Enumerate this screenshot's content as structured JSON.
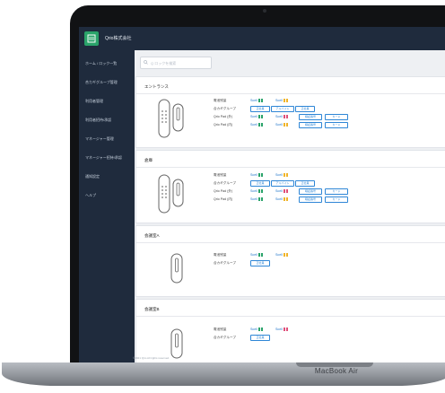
{
  "device": {
    "label": "MacBook Air"
  },
  "app": {
    "company": "Qrio株式会社"
  },
  "search": {
    "placeholder": "Q ロックを検索"
  },
  "sidebar": {
    "items": [
      {
        "label": "ホーム / ロック一覧"
      },
      {
        "label": "合カギグループ管理"
      },
      {
        "label": "利用者管理"
      },
      {
        "label": "利用者招待/承認"
      },
      {
        "label": "マネージャー管理"
      },
      {
        "label": "マネージャー招待/承認"
      },
      {
        "label": "通知設定"
      },
      {
        "label": "ヘルプ"
      }
    ]
  },
  "copyright": "©2021 Qrio All rights reserved.",
  "labels": {
    "battery": "電池残量",
    "key_group": "合カギグループ",
    "pad1": "Qrio Pad (外)",
    "pad2": "Qrio Pad (内)"
  },
  "cards": [
    {
      "title": "エントランス",
      "battery": [
        "Scell",
        "Scell"
      ],
      "groups": [
        "正社員",
        "アルバイト",
        "正社員"
      ],
      "pad1": [
        "Scell",
        "Scell",
        "暗証番号",
        "カード"
      ],
      "pad2": [
        "Scell",
        "Scell",
        "暗証番号",
        "カード"
      ]
    },
    {
      "title": "倉庫",
      "battery": [
        "Scell",
        "Scell"
      ],
      "groups": [
        "正社員",
        "アルバイト",
        "正社員"
      ],
      "pad1": [
        "Scell",
        "Scell",
        "暗証番号",
        "カード"
      ],
      "pad2": [
        "Scell",
        "Scell",
        "暗証番号",
        "カード"
      ]
    },
    {
      "title": "会議室A",
      "battery": [
        "Scell",
        "Scell"
      ],
      "groups": [
        "正社員"
      ]
    },
    {
      "title": "会議室B",
      "battery": [
        "Scell",
        "Scell"
      ],
      "groups": [
        "正社員"
      ]
    }
  ],
  "colors": {
    "accent": "#2aa36a",
    "sidebar": "#1f2b3d",
    "link": "#2e86d6",
    "battery_ok": "#2aa36a",
    "battery_mid": "#f0b429",
    "battery_low": "#e0507a"
  }
}
